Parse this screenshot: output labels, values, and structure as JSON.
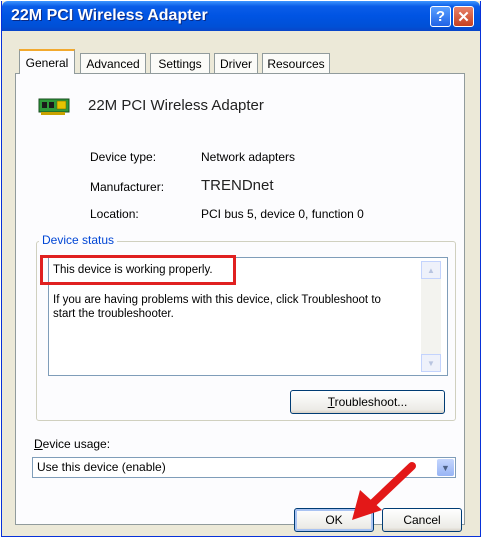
{
  "window": {
    "title": "22M PCI Wireless Adapter",
    "help_symbol": "?",
    "close_symbol": "✕"
  },
  "tabs": [
    {
      "label": "General",
      "active": true
    },
    {
      "label": "Advanced",
      "active": false
    },
    {
      "label": "Settings",
      "active": false
    },
    {
      "label": "Driver",
      "active": false
    },
    {
      "label": "Resources",
      "active": false
    }
  ],
  "device": {
    "icon": "network-card-icon",
    "name": "22M PCI Wireless Adapter",
    "type_label": "Device type:",
    "type_value": "Network adapters",
    "manufacturer_label": "Manufacturer:",
    "manufacturer_value": "TRENDnet",
    "location_label": "Location:",
    "location_value": "PCI bus 5, device 0, function 0"
  },
  "status": {
    "legend": "Device status",
    "line1": "This device is working properly.",
    "line2": "If you are having problems with this device, click Troubleshoot to",
    "line3": "start the troubleshooter.",
    "troubleshoot_prefix": "T",
    "troubleshoot_rest": "roubleshoot..."
  },
  "usage": {
    "label_prefix": "D",
    "label_rest": "evice usage:",
    "selected": "Use this device (enable)"
  },
  "footer": {
    "ok_label": "OK",
    "cancel_label": "Cancel"
  },
  "colors": {
    "titlebar": "#0054e3",
    "highlight": "#e02020",
    "legend": "#0046d5"
  }
}
